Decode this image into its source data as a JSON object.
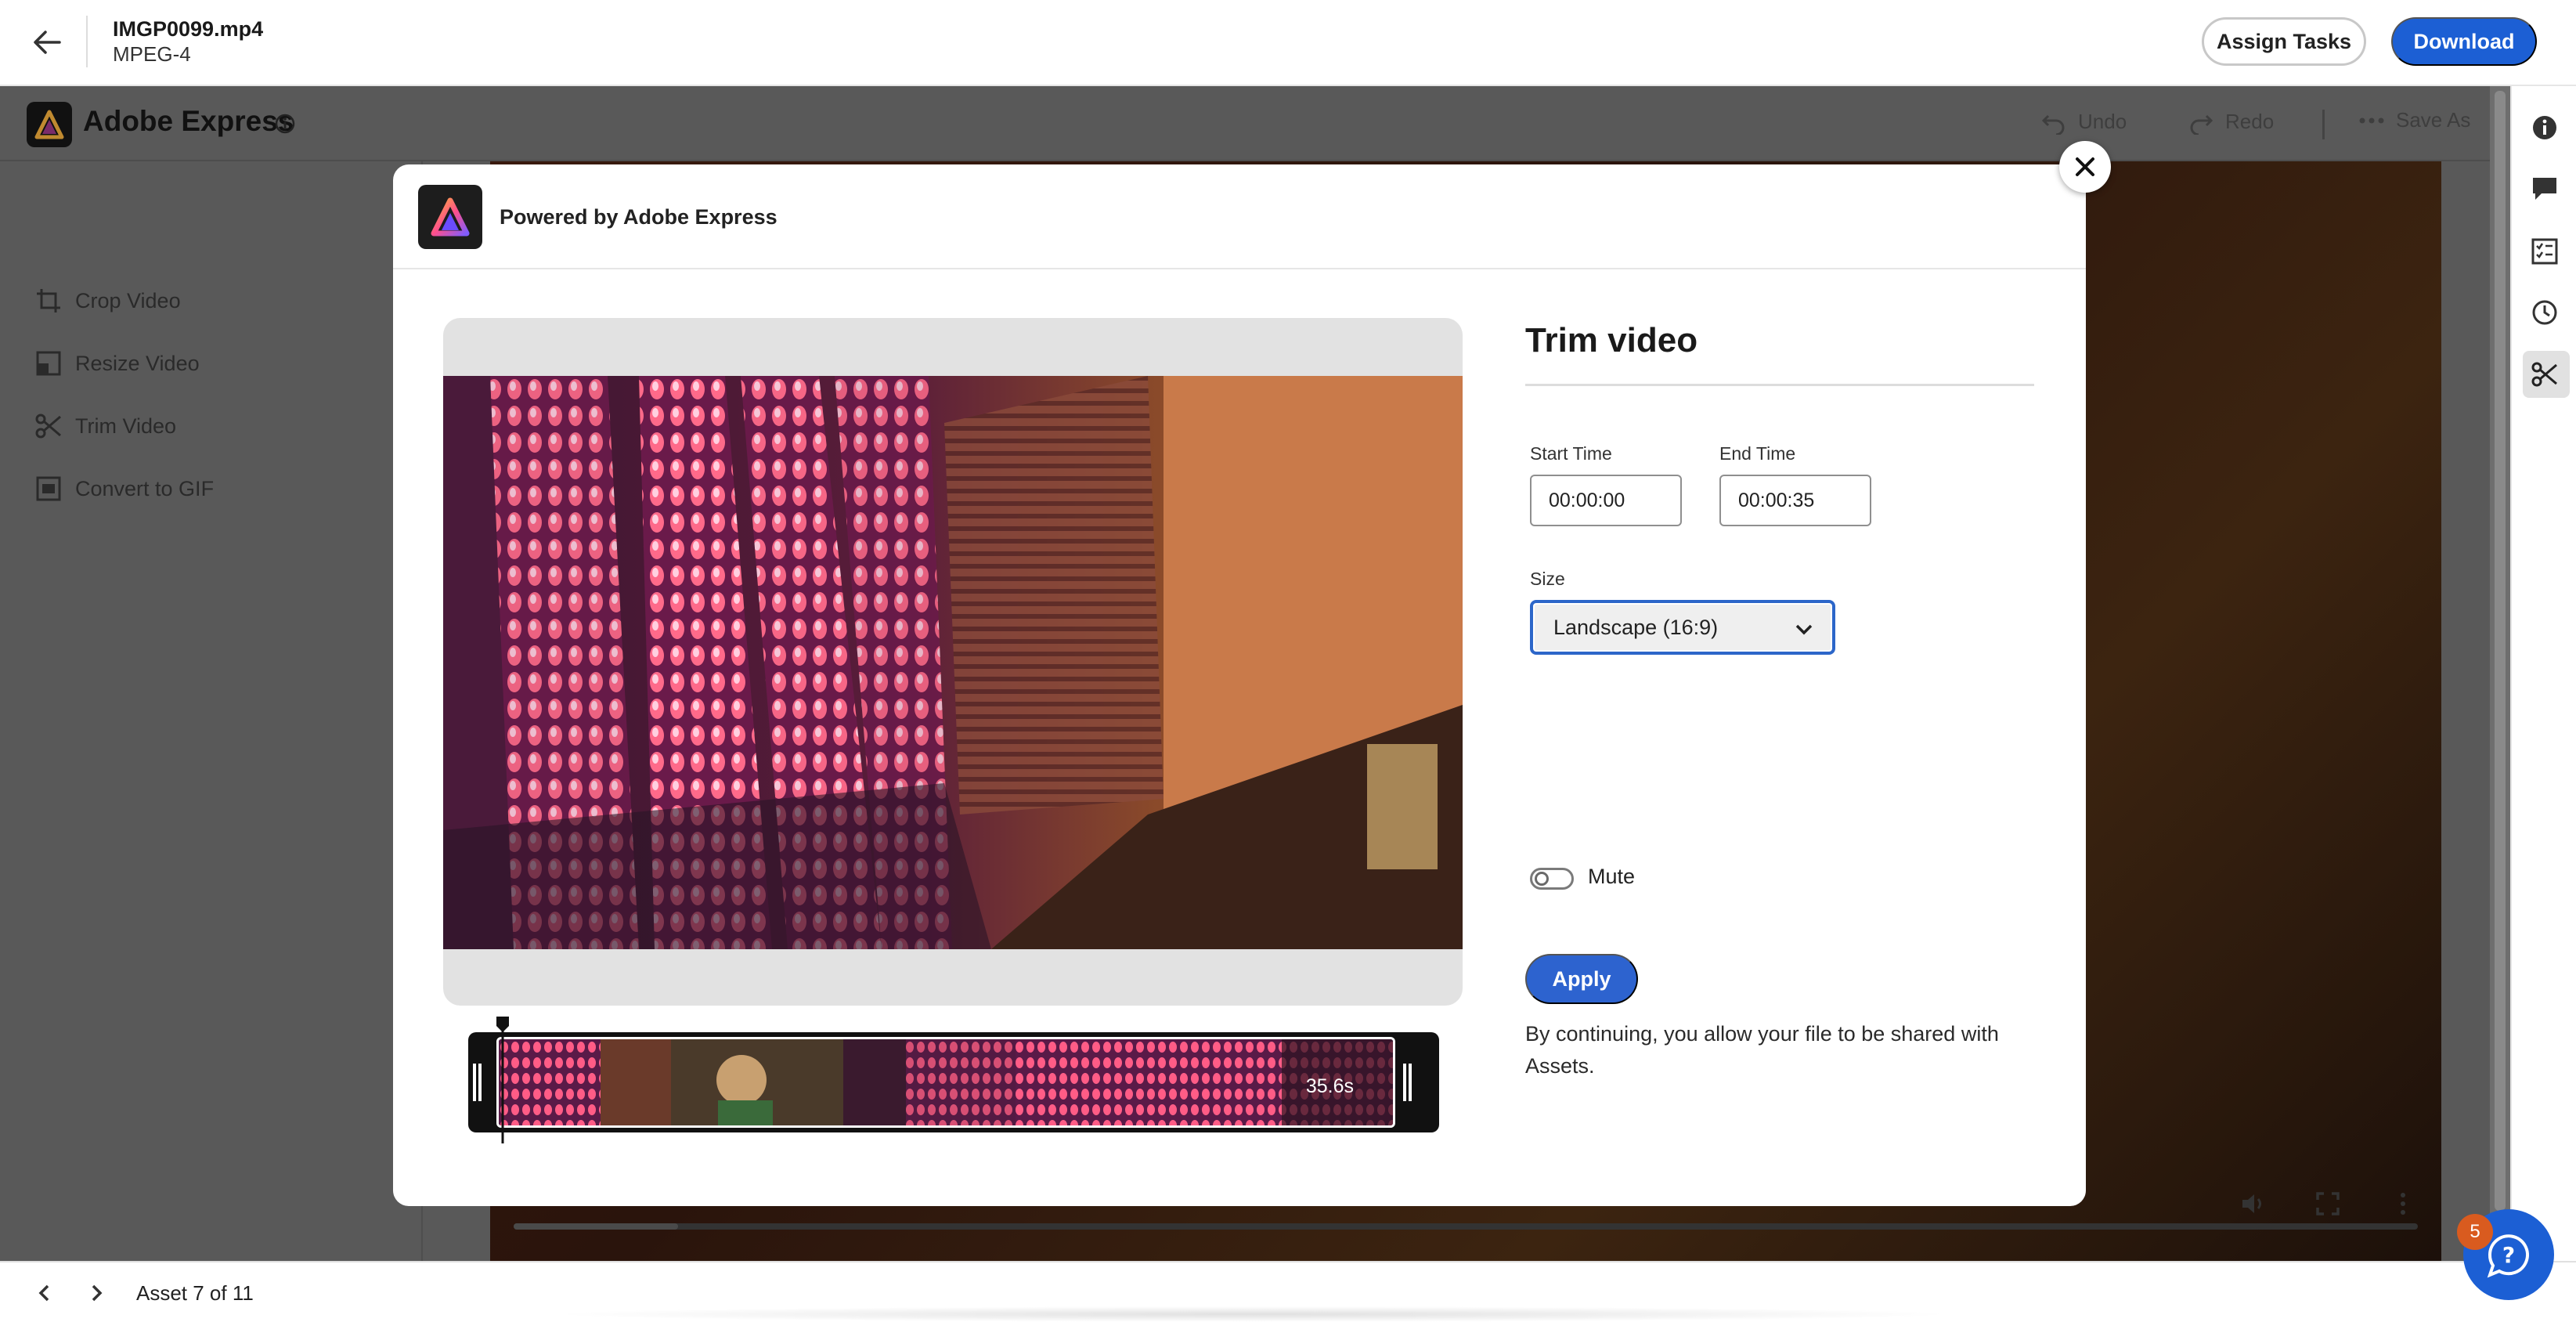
{
  "header": {
    "file_name": "IMGP0099.mp4",
    "file_type": "MPEG-4",
    "assign_label": "Assign Tasks",
    "download_label": "Download"
  },
  "express": {
    "title": "Adobe Express",
    "toolbar": {
      "undo": "Undo",
      "redo": "Redo",
      "save_as": "Save As"
    },
    "menu": [
      {
        "label": "Crop Video",
        "icon": "crop-icon"
      },
      {
        "label": "Resize Video",
        "icon": "resize-icon"
      },
      {
        "label": "Trim Video",
        "icon": "scissors-icon"
      },
      {
        "label": "Convert to GIF",
        "icon": "gif-icon"
      }
    ]
  },
  "modal": {
    "powered_by": "Powered by Adobe Express",
    "title": "Trim video",
    "start_label": "Start Time",
    "start_value": "00:00:00",
    "end_label": "End Time",
    "end_value": "00:00:35",
    "size_label": "Size",
    "size_value": "Landscape (16:9)",
    "mute_label": "Mute",
    "mute_on": false,
    "apply_label": "Apply",
    "consent_text": "By continuing, you allow your file to be shared with Assets.",
    "duration": "35.6s"
  },
  "footer": {
    "asset_counter": "Asset 7 of 11",
    "help_badge": "5"
  },
  "colors": {
    "accent": "#1c5fd4",
    "overlay": "#595959",
    "badge": "#d95b1f"
  },
  "right_rail_icons": [
    "info-icon",
    "comment-icon",
    "checklist-icon",
    "history-icon",
    "scissors-icon"
  ]
}
